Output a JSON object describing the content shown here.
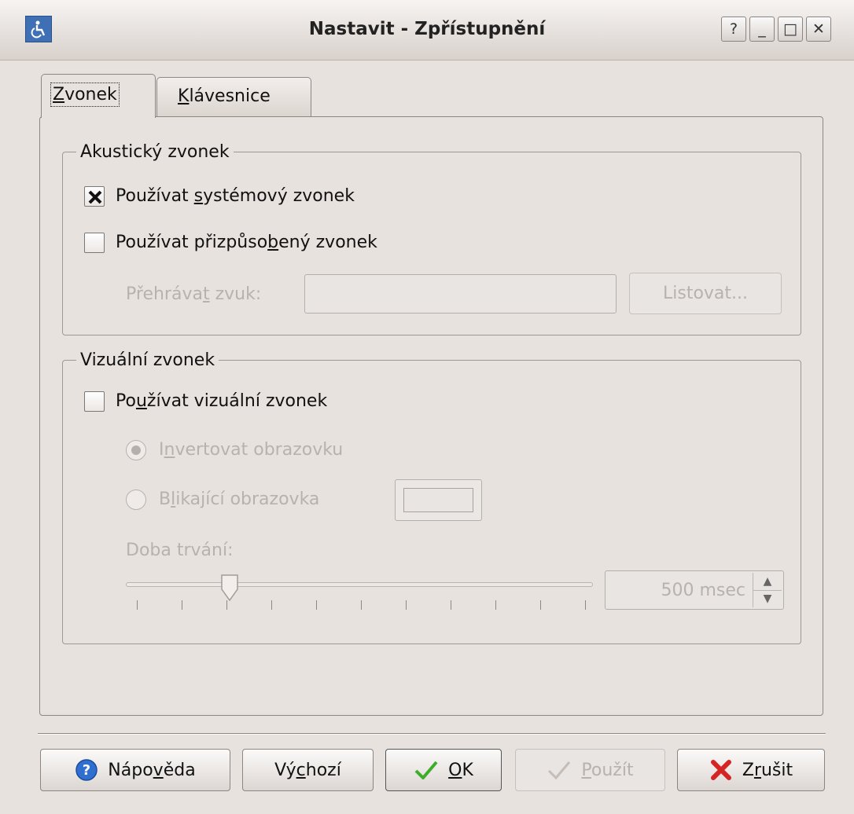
{
  "window": {
    "title": "Nastavit - Zpřístupnění",
    "buttons": {
      "help": "?",
      "minimize": "_",
      "maximize": "□",
      "close": "✕"
    }
  },
  "tabs": [
    {
      "pre": "",
      "key": "Z",
      "post": "vonek"
    },
    {
      "pre": "",
      "key": "K",
      "post": "lávesnice"
    }
  ],
  "acoustic": {
    "legend": "Akustický zvonek",
    "use_system": {
      "pre": "Používat ",
      "key": "s",
      "post": "ystémový zvonek",
      "checked": true
    },
    "use_custom": {
      "pre": "Používat přizpůso",
      "key": "b",
      "post": "ený zvonek",
      "checked": false
    },
    "play_sound": {
      "pre": "Přehráva",
      "key": "t",
      "post": " zvuk:"
    },
    "play_sound_value": "",
    "browse": "Listovat..."
  },
  "visual": {
    "legend": "Vizuální zvonek",
    "use_visual": {
      "pre": "Po",
      "key": "u",
      "post": "žívat vizuální zvonek",
      "checked": false
    },
    "invert": {
      "pre": "I",
      "key": "n",
      "post": "vertovat obrazovku",
      "selected": true
    },
    "flash": {
      "pre": "B",
      "key": "l",
      "post": "ikající obrazovka",
      "selected": false
    },
    "duration_label": "Doba trvání:",
    "duration_value": "500 msec"
  },
  "footer": {
    "help": {
      "pre": "Nápo",
      "key": "v",
      "post": "ěda"
    },
    "defaults": {
      "pre": "Vý",
      "key": "c",
      "post": "hozí"
    },
    "ok": {
      "pre": "",
      "key": "O",
      "post": "K"
    },
    "apply": {
      "pre": "",
      "key": "P",
      "post": "oužít"
    },
    "cancel": {
      "pre": "Z",
      "key": "r",
      "post": "ušit"
    }
  },
  "colors": {
    "accent": "#3f6fb5",
    "disabled_text": "#b8b2ae",
    "check_green": "#3cae2a",
    "cancel_red": "#d42424"
  }
}
